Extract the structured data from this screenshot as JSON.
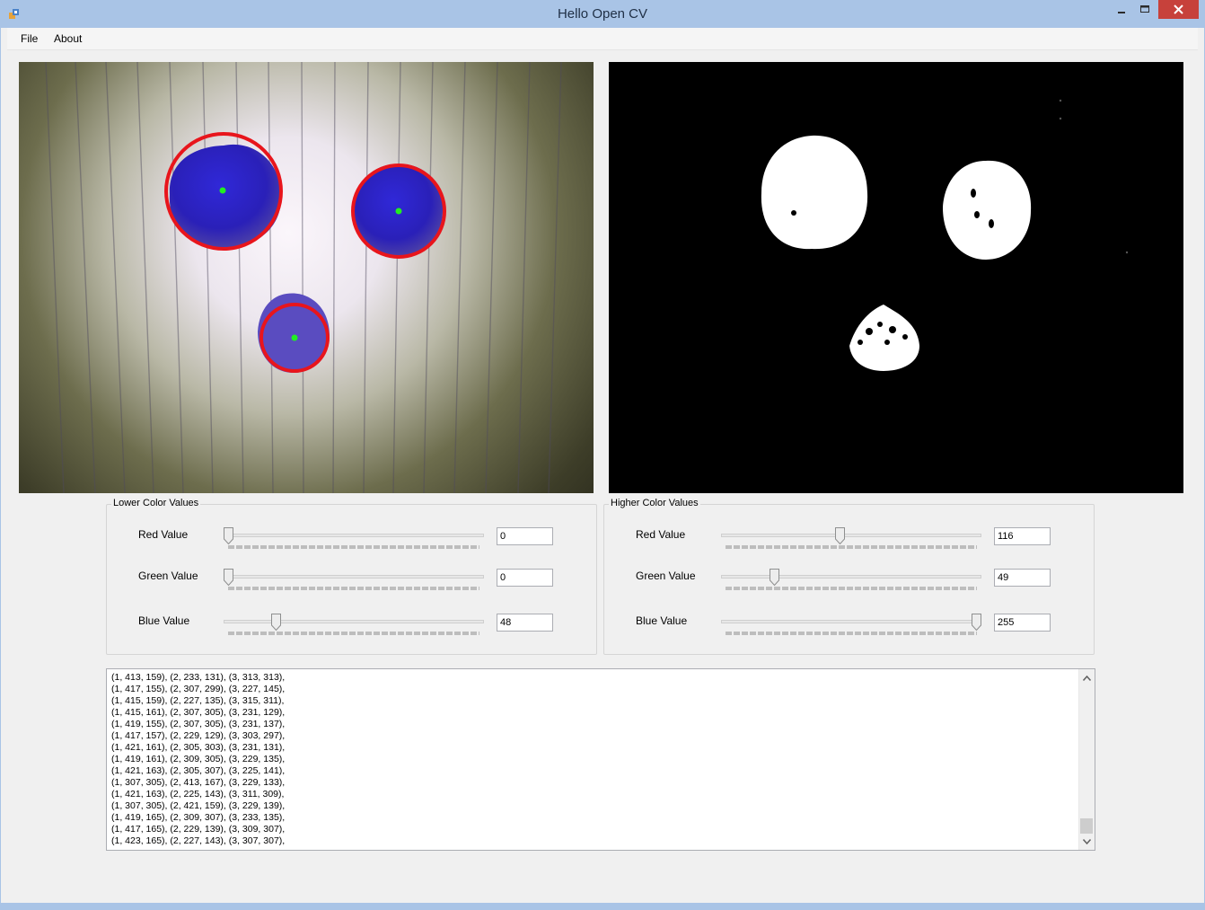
{
  "window": {
    "title": "Hello Open CV"
  },
  "menu": {
    "items": [
      {
        "label": "File"
      },
      {
        "label": "About"
      }
    ]
  },
  "lower": {
    "title": "Lower Color Values",
    "rows": [
      {
        "label": "Red Value",
        "value": "0",
        "level": 0
      },
      {
        "label": "Green Value",
        "value": "0",
        "level": 0
      },
      {
        "label": "Blue Value",
        "value": "48",
        "level": 48
      }
    ]
  },
  "higher": {
    "title": "Higher Color Values",
    "rows": [
      {
        "label": "Red Value",
        "value": "116",
        "level": 116
      },
      {
        "label": "Green Value",
        "value": "49",
        "level": 49
      },
      {
        "label": "Blue Value",
        "value": "255",
        "level": 255
      }
    ]
  },
  "log": {
    "lines": [
      "(1, 413, 159), (2, 233, 131), (3, 313, 313),",
      "(1, 417, 155), (2, 307, 299), (3, 227, 145),",
      "(1, 415, 159), (2, 227, 135), (3, 315, 311),",
      "(1, 415, 161), (2, 307, 305), (3, 231, 129),",
      "(1, 419, 155), (2, 307, 305), (3, 231, 137),",
      "(1, 417, 157), (2, 229, 129), (3, 303, 297),",
      "(1, 421, 161), (2, 305, 303), (3, 231, 131),",
      "(1, 419, 161), (2, 309, 305), (3, 229, 135),",
      "(1, 421, 163), (2, 305, 307), (3, 225, 141),",
      "(1, 307, 305), (2, 413, 167), (3, 229, 133),",
      "(1, 421, 163), (2, 225, 143), (3, 311, 309),",
      "(1, 307, 305), (2, 421, 159), (3, 229, 139),",
      "(1, 419, 165), (2, 309, 307), (3, 233, 135),",
      "(1, 417, 165), (2, 229, 139), (3, 309, 307),",
      "(1, 423, 165), (2, 227, 143), (3, 307, 307),"
    ]
  },
  "icons": {
    "app": "app-icon",
    "minimize": "minimize-icon",
    "maximize": "maximize-icon",
    "close": "close-icon",
    "scroll_up": "chevron-up-icon",
    "scroll_down": "chevron-down-icon"
  },
  "colors": {
    "titlebar": "#a9c4e6",
    "close": "#c7413b",
    "circle": "#e8151c",
    "center": "#22ee22",
    "blob": "#3a2fd0"
  }
}
